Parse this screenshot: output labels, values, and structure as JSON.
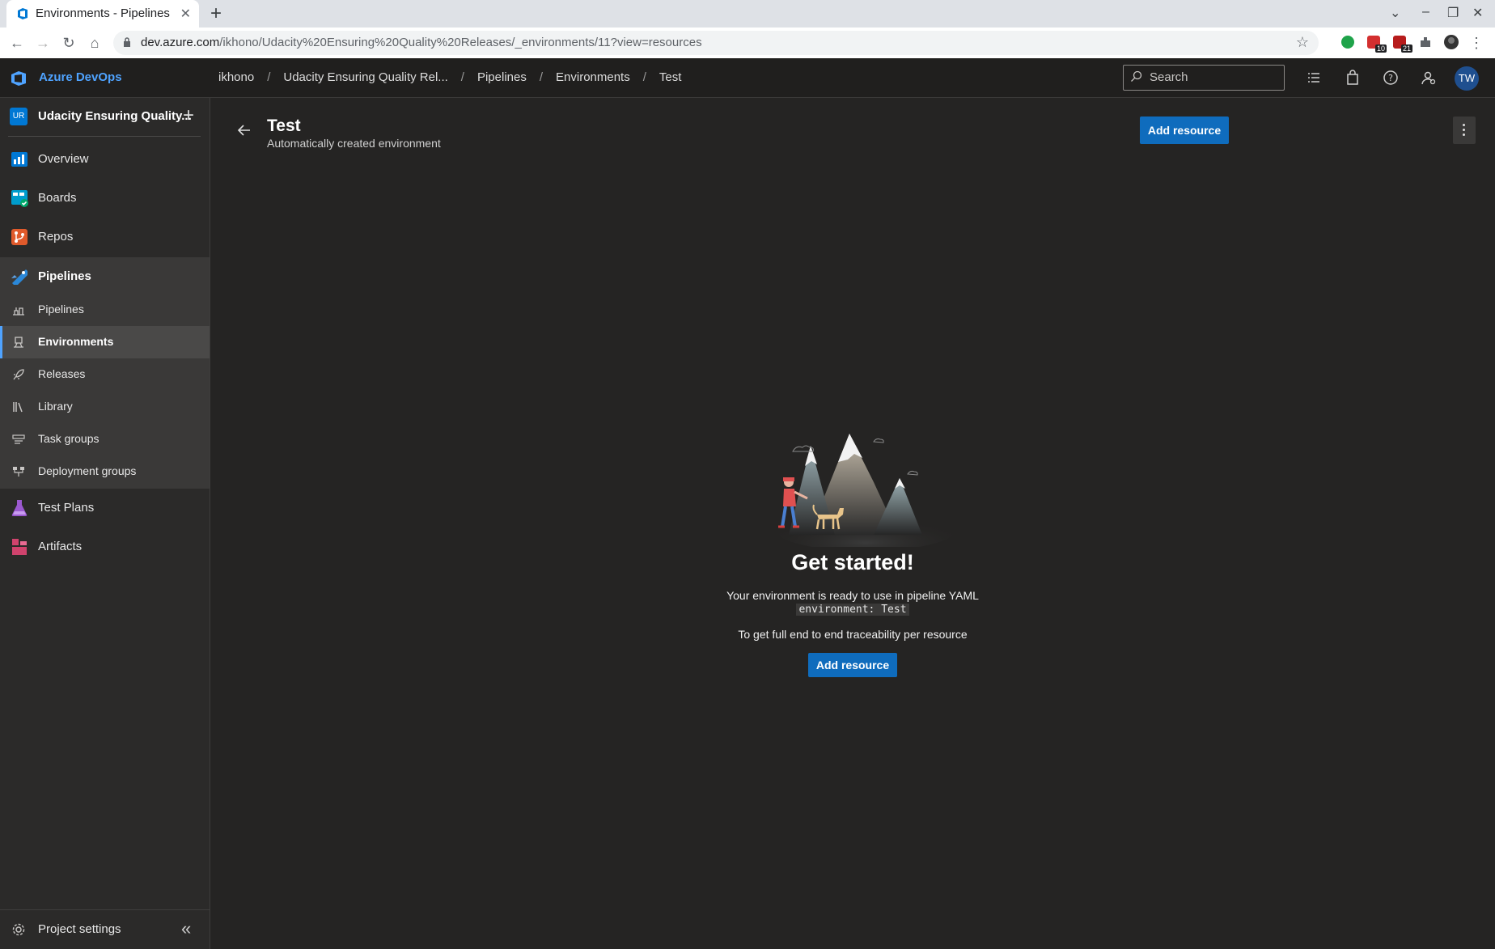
{
  "browser": {
    "tab_title": "Environments - Pipelines",
    "url_host": "dev.azure.com",
    "url_path": "/ikhono/Udacity%20Ensuring%20Quality%20Releases/_environments/11?view=resources",
    "ext_badge_1": "10",
    "ext_badge_2": "21"
  },
  "header": {
    "brand": "Azure DevOps",
    "breadcrumbs": [
      "ikhono",
      "Udacity Ensuring Quality Rel...",
      "Pipelines",
      "Environments",
      "Test"
    ],
    "search_placeholder": "Search",
    "avatar_initials": "TW"
  },
  "sidebar": {
    "project_initials": "UR",
    "project_name": "Udacity Ensuring Quality...",
    "items": [
      {
        "label": "Overview",
        "icon": "overview-icon",
        "color": "#0078d4"
      },
      {
        "label": "Boards",
        "icon": "boards-icon",
        "color": "#009ccc"
      },
      {
        "label": "Repos",
        "icon": "repos-icon",
        "color": "#e05a2b"
      },
      {
        "label": "Pipelines",
        "icon": "pipelines-icon",
        "color": "#2b88d8"
      },
      {
        "label": "Test Plans",
        "icon": "test-plans-icon",
        "color": "#9b59d0"
      },
      {
        "label": "Artifacts",
        "icon": "artifacts-icon",
        "color": "#d0436d"
      }
    ],
    "sub_items": [
      {
        "label": "Pipelines",
        "icon": "pipelines-sub-icon"
      },
      {
        "label": "Environments",
        "icon": "environments-icon",
        "selected": true
      },
      {
        "label": "Releases",
        "icon": "rocket-icon"
      },
      {
        "label": "Library",
        "icon": "library-icon"
      },
      {
        "label": "Task groups",
        "icon": "task-groups-icon"
      },
      {
        "label": "Deployment groups",
        "icon": "deployment-groups-icon"
      }
    ],
    "settings_label": "Project settings"
  },
  "main": {
    "title": "Test",
    "subtitle": "Automatically created environment",
    "add_resource_label": "Add resource",
    "empty_state": {
      "heading": "Get started!",
      "line1": "Your environment is ready to use in pipeline YAML",
      "code": "environment: Test",
      "line2": "To get full end to end traceability per resource",
      "button_label": "Add resource"
    }
  }
}
